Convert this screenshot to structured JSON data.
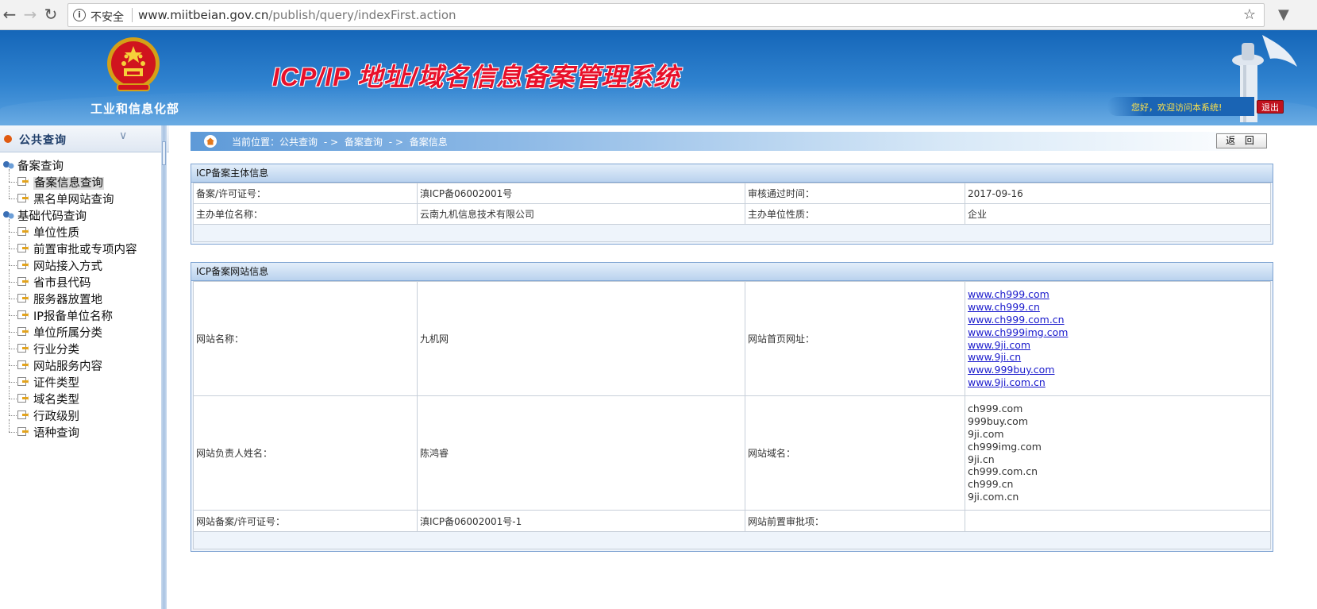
{
  "browser": {
    "security_label": "不安全",
    "url_host": "www.miitbeian.gov.cn",
    "url_path": "/publish/query/indexFirst.action"
  },
  "header": {
    "ministry": "工业和信息化部",
    "system_title": "ICP/IP 地址/域名信息备案管理系统",
    "welcome": "您好，欢迎访问本系统!",
    "logout": "退出"
  },
  "sidebar": {
    "title": "公共查询",
    "tree": [
      {
        "label": "备案查询",
        "level": 0
      },
      {
        "label": "备案信息查询",
        "level": 1,
        "active": true
      },
      {
        "label": "黑名单网站查询",
        "level": 1
      },
      {
        "label": "基础代码查询",
        "level": 0
      },
      {
        "label": "单位性质",
        "level": 1
      },
      {
        "label": "前置审批或专项内容",
        "level": 1
      },
      {
        "label": "网站接入方式",
        "level": 1
      },
      {
        "label": "省市县代码",
        "level": 1
      },
      {
        "label": "服务器放置地",
        "level": 1
      },
      {
        "label": "IP报备单位名称",
        "level": 1
      },
      {
        "label": "单位所属分类",
        "level": 1
      },
      {
        "label": "行业分类",
        "level": 1
      },
      {
        "label": "网站服务内容",
        "level": 1
      },
      {
        "label": "证件类型",
        "level": 1
      },
      {
        "label": "域名类型",
        "level": 1
      },
      {
        "label": "行政级别",
        "level": 1
      },
      {
        "label": "语种查询",
        "level": 1
      }
    ]
  },
  "breadcrumb": {
    "current": "当前位置：公共查询",
    "sep1": "- >",
    "level2": "备案查询",
    "sep2": "- >",
    "level3": "备案信息"
  },
  "back_button": "返 回",
  "entity_panel": {
    "title": "ICP备案主体信息",
    "license_label": "备案/许可证号：",
    "license_value": "滇ICP备06002001号",
    "approve_time_label": "审核通过时间：",
    "approve_time_value": "2017-09-16",
    "org_name_label": "主办单位名称：",
    "org_name_value": "云南九机信息技术有限公司",
    "org_type_label": "主办单位性质：",
    "org_type_value": "企业"
  },
  "site_panel": {
    "title": "ICP备案网站信息",
    "site_name_label": "网站名称：",
    "site_name_value": "九机网",
    "homepage_label": "网站首页网址：",
    "homepage_urls": [
      "www.ch999.com",
      "www.ch999.cn",
      "www.ch999.com.cn",
      "www.ch999img.com",
      "www.9ji.com",
      "www.9ji.cn",
      "www.999buy.com",
      "www.9ji.com.cn"
    ],
    "owner_label": "网站负责人姓名：",
    "owner_value": "陈鸿睿",
    "domain_label": "网站域名：",
    "domains": [
      "ch999.com",
      "999buy.com",
      "9ji.com",
      "ch999img.com",
      "9ji.cn",
      "ch999.com.cn",
      "ch999.cn",
      "9ji.com.cn"
    ],
    "site_license_label": "网站备案/许可证号：",
    "site_license_value": "滇ICP备06002001号-1",
    "pre_approval_label": "网站前置审批项：",
    "pre_approval_value": ""
  },
  "colors": {
    "header_blue": "#1f6fc0",
    "title_red": "#e8102a",
    "link_blue": "#1a1acc",
    "logout_red": "#c0121e"
  }
}
